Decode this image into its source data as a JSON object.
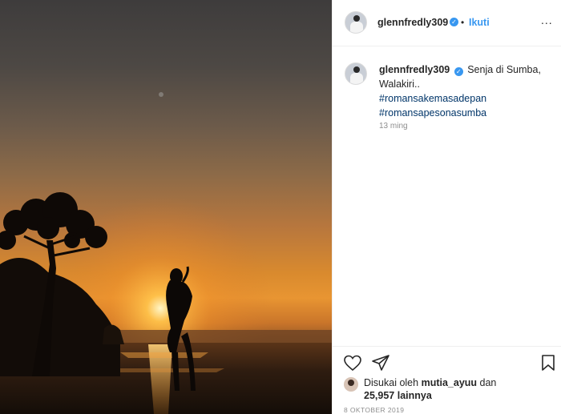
{
  "post": {
    "username": "glennfredly309",
    "follow_label": "Ikuti",
    "separator": "•",
    "more_label": "...",
    "caption_text": "Senja di Sumba, Walakiri..",
    "hashtags": [
      "#romansakemasadepan",
      "#romansapesonasumba"
    ],
    "time_ago": "13 ming",
    "likes": {
      "prefix": "Disukai oleh",
      "user": "mutia_ayuu",
      "and": "dan",
      "count": "25,957",
      "suffix": "lainnya"
    },
    "date": "8 OKTOBER 2019"
  },
  "icons": {
    "verified": "verified-badge-icon",
    "like": "heart-icon",
    "share": "paper-plane-icon",
    "save": "bookmark-icon"
  },
  "colors": {
    "link_blue": "#3897f0",
    "hashtag": "#003569",
    "muted": "#8e8e8e"
  }
}
